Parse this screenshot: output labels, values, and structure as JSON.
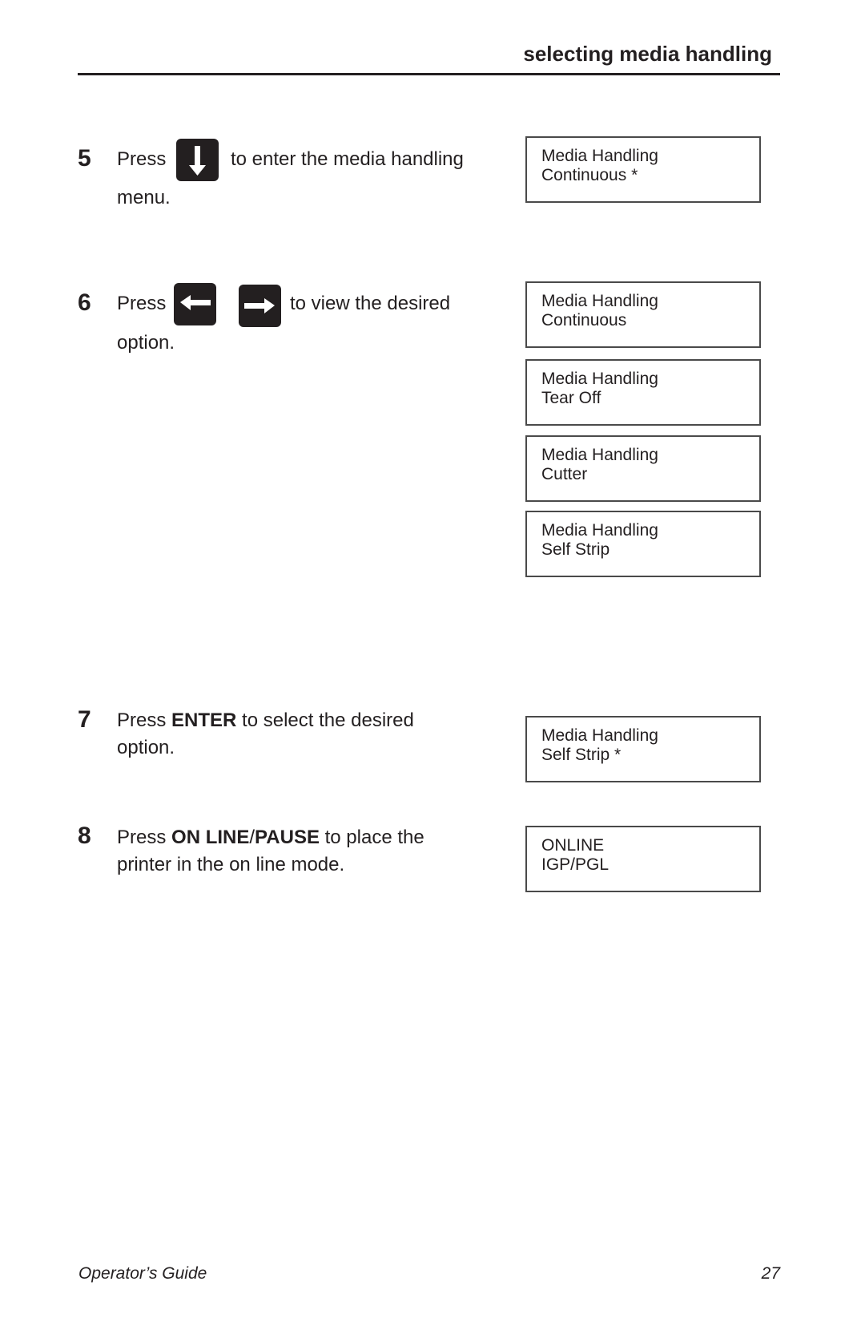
{
  "header": {
    "title": "selecting media handling"
  },
  "steps": [
    {
      "number": "5",
      "prefix": "Press",
      "suffix": "to enter the media handling",
      "line2": "menu.",
      "keys": [
        "down-arrow-key"
      ]
    },
    {
      "number": "6",
      "prefix": "Press",
      "suffix": "to view the desired",
      "line2": "option.",
      "keys": [
        "left-arrow-key",
        "right-arrow-key"
      ]
    },
    {
      "number": "7",
      "prefix": "Press",
      "bold": "ENTER",
      "suffix": "to select the desired",
      "line2": "option."
    },
    {
      "number": "8",
      "prefix": "Press",
      "bold1": "ON LINE",
      "slash": "/",
      "bold2": "PAUSE",
      "suffix": "to place the",
      "line2": "printer in the on line mode."
    }
  ],
  "displays": [
    {
      "line1": "Media Handling",
      "line2": "Continuous *"
    },
    {
      "line1": "Media Handling",
      "line2": "Continuous"
    },
    {
      "line1": "Media Handling",
      "line2": "Tear Off"
    },
    {
      "line1": "Media Handling",
      "line2": "Cutter"
    },
    {
      "line1": "Media Handling",
      "line2": "Self Strip"
    },
    {
      "line1": "Media Handling",
      "line2": "Self Strip *"
    },
    {
      "line1": "ONLINE",
      "line2": "IGP/PGL"
    }
  ],
  "footer": {
    "left": "Operator’s Guide",
    "page_number": "27"
  }
}
